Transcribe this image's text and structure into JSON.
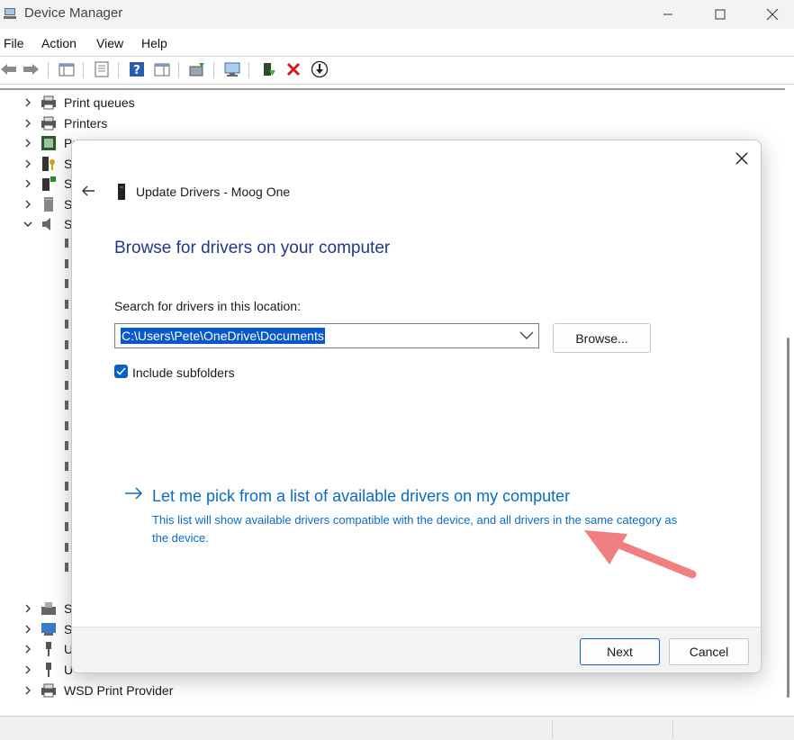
{
  "window": {
    "title": "Device Manager"
  },
  "menu": [
    "File",
    "Action",
    "View",
    "Help"
  ],
  "tree": {
    "rows": [
      {
        "label": "Print queues",
        "expanded": false,
        "icon": "print-queue-icon"
      },
      {
        "label": "Printers",
        "expanded": false,
        "icon": "printer-icon"
      },
      {
        "label": "Pr",
        "expanded": false,
        "icon": "processor-icon"
      },
      {
        "label": "S",
        "expanded": false,
        "icon": "security-device-icon"
      },
      {
        "label": "S",
        "expanded": false,
        "icon": "software-component-icon"
      },
      {
        "label": "S",
        "expanded": false,
        "icon": "storage-controller-icon"
      },
      {
        "label": "S",
        "expanded": true,
        "icon": "sound-icon"
      }
    ],
    "bottom_rows": [
      {
        "label": "S",
        "icon": "system-devices-icon"
      },
      {
        "label": "S",
        "icon": "system-icon"
      },
      {
        "label": "U",
        "icon": "usb-icon"
      },
      {
        "label": "U",
        "icon": "usb-icon"
      },
      {
        "label": "WSD Print Provider",
        "icon": "printer-icon"
      }
    ]
  },
  "dialog": {
    "title": "Update Drivers - Moog One",
    "heading": "Browse for drivers on your computer",
    "search_label": "Search for drivers in this location:",
    "path_value": "C:\\Users\\Pete\\OneDrive\\Documents",
    "browse_label": "Browse...",
    "include_subfolders_label": "Include subfolders",
    "include_subfolders_checked": true,
    "pick_title": "Let me pick from a list of available drivers on my computer",
    "pick_desc": "This list will show available drivers compatible with the device, and all drivers in the same category as the device.",
    "next_label": "Next",
    "cancel_label": "Cancel"
  },
  "colors": {
    "accent": "#0a5fc4",
    "link": "#0b6bc8",
    "heading": "#20388e",
    "annotation_arrow": "#f08080"
  }
}
